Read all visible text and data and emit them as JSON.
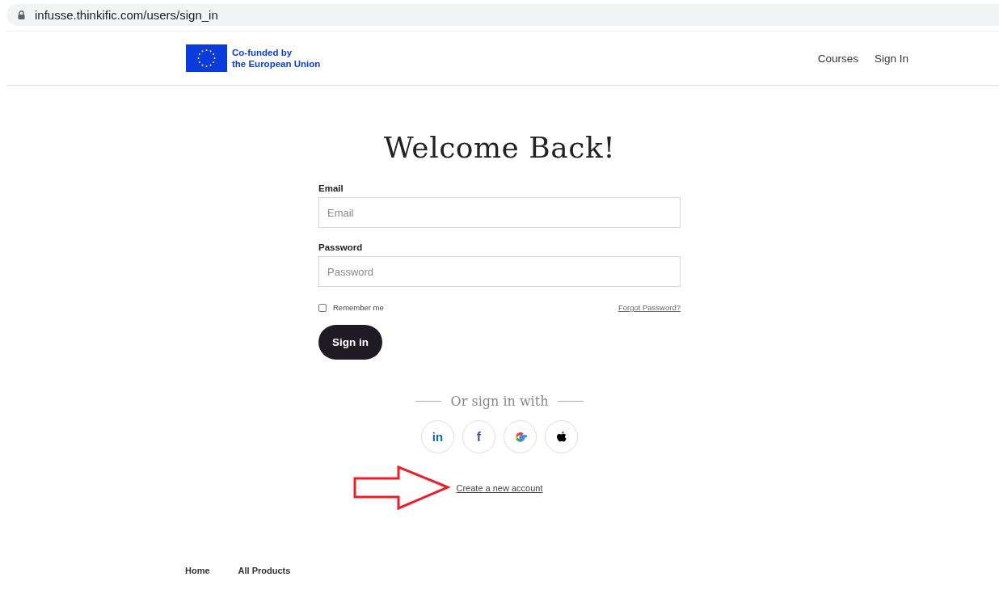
{
  "address_bar": {
    "url": "infusse.thinkific.com/users/sign_in"
  },
  "header": {
    "logo_text": [
      "Co-funded by",
      "the European Union"
    ],
    "nav": [
      "Courses",
      "Sign In"
    ]
  },
  "title": "Welcome Back!",
  "form": {
    "fields": [
      {
        "label": "Email",
        "placeholder": "Email"
      },
      {
        "label": "Password",
        "placeholder": "Password"
      }
    ],
    "remember": {
      "label": "Remember me",
      "checked": false
    },
    "forgot": "Forgot Password?",
    "submit": "Sign in"
  },
  "social": {
    "heading": "Or sign in with",
    "buttons": [
      {
        "kind": "linkedin",
        "text": "in"
      },
      {
        "kind": "facebook",
        "text": "f"
      },
      {
        "kind": "google"
      },
      {
        "kind": "apple"
      }
    ]
  },
  "create_account": "Create a new account",
  "annotation": {
    "kind": "arrow"
  },
  "footer": {
    "links": [
      "Home",
      "All Products"
    ]
  }
}
